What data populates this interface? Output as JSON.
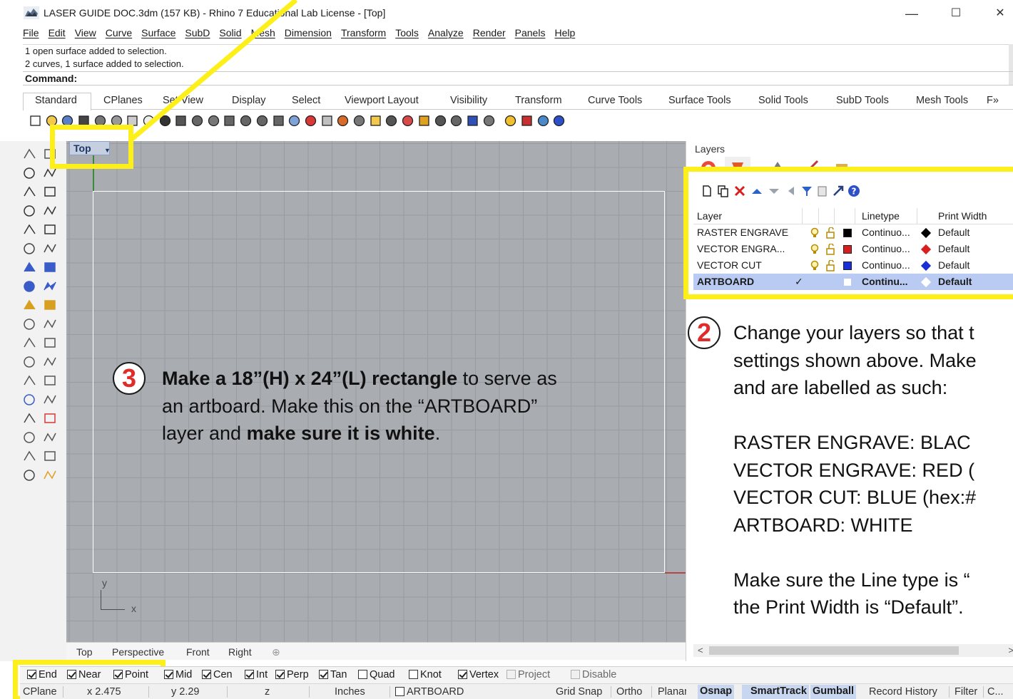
{
  "window": {
    "title": "LASER GUIDE DOC.3dm (157 KB) - Rhino 7 Educational Lab License - [Top]",
    "minimize": "—",
    "maximize": "☐",
    "close": "✕"
  },
  "menu": [
    "File",
    "Edit",
    "View",
    "Curve",
    "Surface",
    "SubD",
    "Solid",
    "Mesh",
    "Dimension",
    "Transform",
    "Tools",
    "Analyze",
    "Render",
    "Panels",
    "Help"
  ],
  "history": {
    "line1": "1 open surface added to selection.",
    "line2": "2 curves, 1 surface added to selection.",
    "command_label": "Command:"
  },
  "toolbar_tabs": [
    "Standard",
    "CPlanes",
    "Set View",
    "Display",
    "Select",
    "Viewport Layout",
    "Visibility",
    "Transform",
    "Curve Tools",
    "Surface Tools",
    "Solid Tools",
    "SubD Tools",
    "Mesh Tools",
    "F»"
  ],
  "viewport": {
    "name": "Top",
    "dropdown": "▼",
    "axis_x": "x",
    "axis_y": "y",
    "tabs": [
      "Top",
      "Perspective",
      "Front",
      "Right"
    ],
    "add_tab": "⊕"
  },
  "layers_panel": {
    "title": "Layers",
    "columns": {
      "layer": "Layer",
      "linetype": "Linetype",
      "print_width": "Print Width"
    },
    "rows": [
      {
        "name": "RASTER ENGRAVE",
        "linetype": "Continuo...",
        "print_width": "Default",
        "color": "#000000",
        "current": false
      },
      {
        "name": "VECTOR ENGRA...",
        "linetype": "Continuo...",
        "print_width": "Default",
        "color": "#d81e1e",
        "current": false
      },
      {
        "name": "VECTOR CUT",
        "linetype": "Continuo...",
        "print_width": "Default",
        "color": "#1a2fd8",
        "current": false
      },
      {
        "name": "ARTBOARD",
        "linetype": "Continu...",
        "print_width": "Default",
        "color": "#ffffff",
        "current": true,
        "check": "✓"
      }
    ]
  },
  "annotations": {
    "step2_number": "2",
    "step2_lines": [
      "Change your layers so that t",
      "settings shown above. Make",
      "and are labelled as such:",
      "",
      "RASTER ENGRAVE: BLAC",
      "VECTOR ENGRAVE: RED (",
      "VECTOR CUT: BLUE (hex:#",
      "ARTBOARD: WHITE",
      "",
      "Make sure the Line type is “",
      "the Print Width is “Default”."
    ],
    "step3_number": "3",
    "step3_line1_bold": "Make a 18”(H) x 24”(L) rectangle",
    "step3_line1_rest": " to serve as",
    "step3_line2": "an artboard. Make this on the “ARTBOARD”",
    "step3_line3_pre": "layer and ",
    "step3_line3_bold": "make sure it is white",
    "step3_line3_post": ".",
    "highlight_color": "#fdf01a",
    "badge_color": "#e02b2b"
  },
  "osnap": [
    {
      "label": "End",
      "checked": true,
      "dim": false
    },
    {
      "label": "Near",
      "checked": true,
      "dim": false
    },
    {
      "label": "Point",
      "checked": true,
      "dim": false
    },
    {
      "label": "Mid",
      "checked": true,
      "dim": false
    },
    {
      "label": "Cen",
      "checked": true,
      "dim": false
    },
    {
      "label": "Int",
      "checked": true,
      "dim": false
    },
    {
      "label": "Perp",
      "checked": true,
      "dim": false
    },
    {
      "label": "Tan",
      "checked": true,
      "dim": false
    },
    {
      "label": "Quad",
      "checked": false,
      "dim": false
    },
    {
      "label": "Knot",
      "checked": false,
      "dim": false
    },
    {
      "label": "Vertex",
      "checked": true,
      "dim": false
    },
    {
      "label": "Project",
      "checked": false,
      "dim": true
    },
    {
      "label": "Disable",
      "checked": false,
      "dim": true
    }
  ],
  "status": {
    "cplane": "CPlane",
    "x": "x 2.475",
    "y": "y 2.29",
    "z": "z",
    "units": "Inches",
    "layer": "ARTBOARD",
    "grid_snap": "Grid Snap",
    "ortho": "Ortho",
    "planar": "Planar",
    "osnap": "Osnap",
    "smarttrack": "SmartTrack",
    "gumball": "Gumball",
    "record_history": "Record History",
    "filter": "Filter",
    "cpu": "C..."
  }
}
